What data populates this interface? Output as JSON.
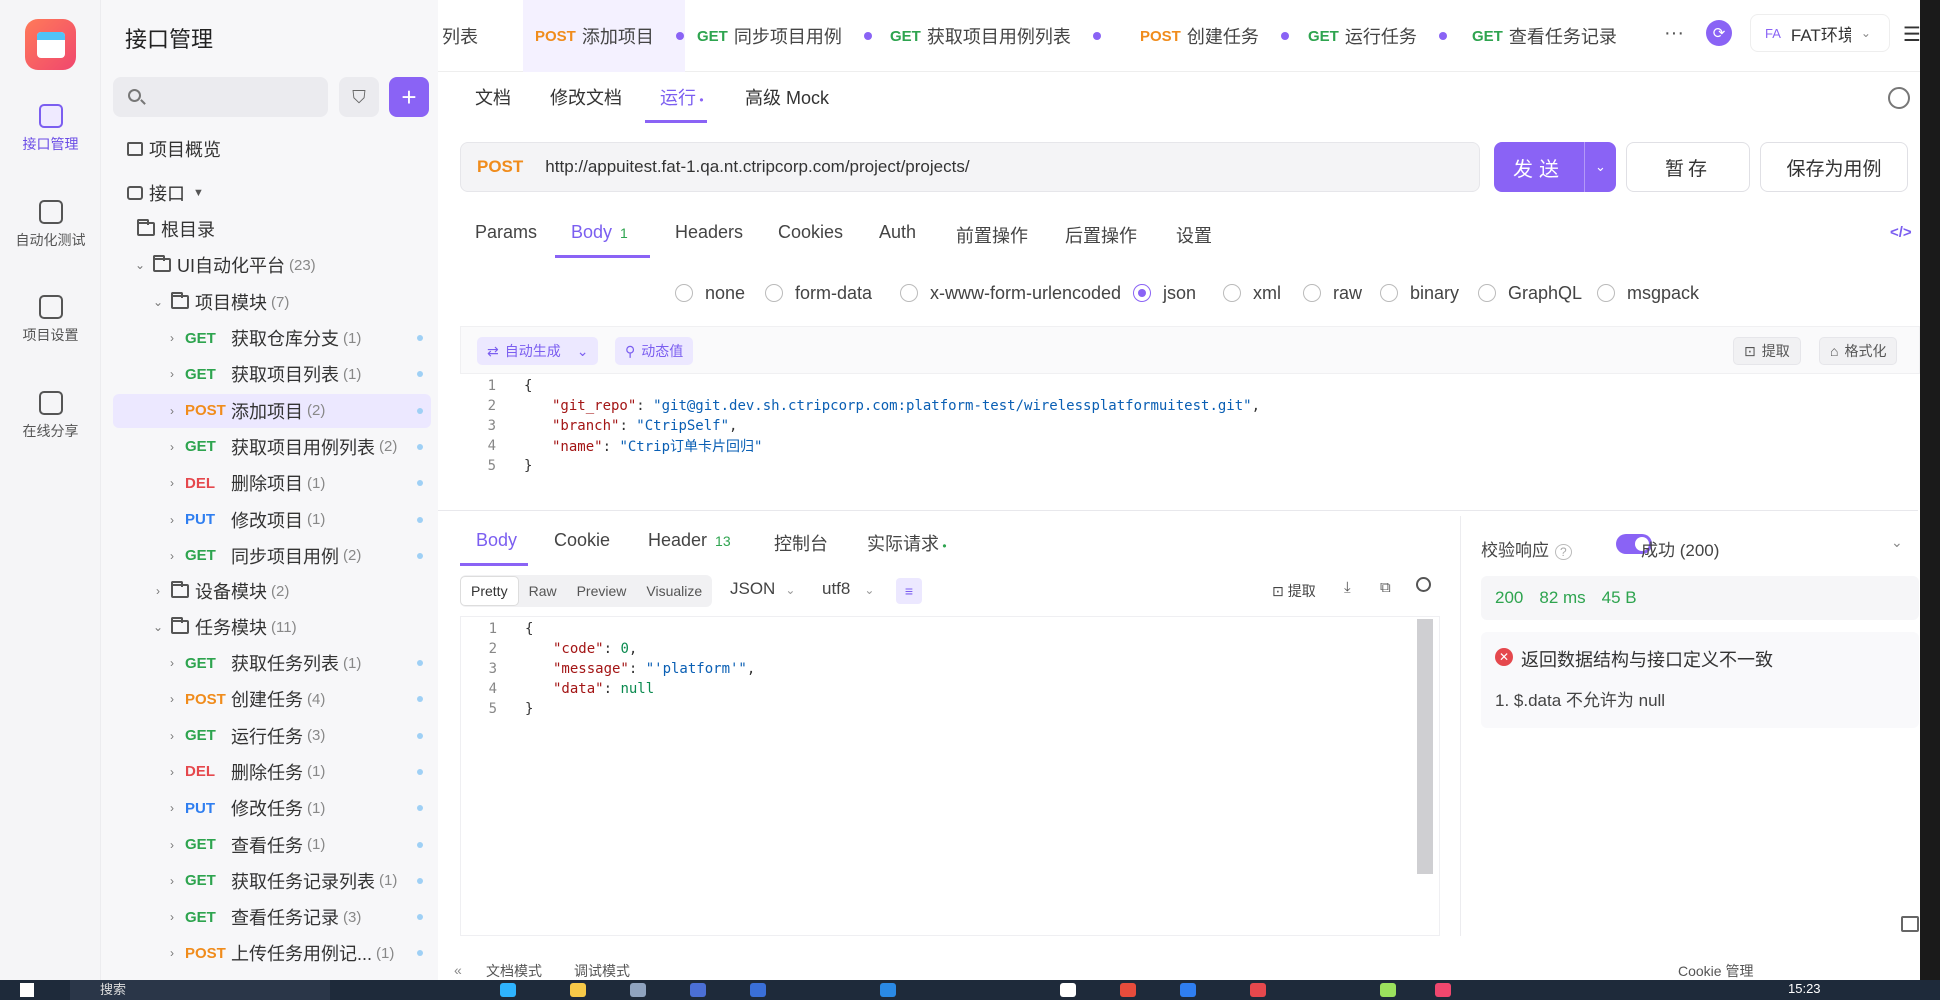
{
  "rail": {
    "items": [
      {
        "label": "接口管理",
        "icon": "api-icon"
      },
      {
        "label": "自动化测试",
        "icon": "automation-icon"
      },
      {
        "label": "项目设置",
        "icon": "settings-icon"
      },
      {
        "label": "在线分享",
        "icon": "share-icon"
      }
    ]
  },
  "sidebar": {
    "title": "接口管理",
    "search_placeholder": "",
    "overview": "项目概览",
    "api_root": "接口",
    "root_dir": "根目录",
    "platform": {
      "name": "UI自动化平台",
      "count": "(23)"
    },
    "project_module": {
      "name": "项目模块",
      "count": "(7)"
    },
    "project_items": [
      {
        "method": "GET",
        "name": "获取仓库分支",
        "count": "(1)"
      },
      {
        "method": "GET",
        "name": "获取项目列表",
        "count": "(1)"
      },
      {
        "method": "POST",
        "name": "添加项目",
        "count": "(2)"
      },
      {
        "method": "GET",
        "name": "获取项目用例列表",
        "count": "(2)"
      },
      {
        "method": "DEL",
        "name": "删除项目",
        "count": "(1)"
      },
      {
        "method": "PUT",
        "name": "修改项目",
        "count": "(1)"
      },
      {
        "method": "GET",
        "name": "同步项目用例",
        "count": "(2)"
      }
    ],
    "device_module": {
      "name": "设备模块",
      "count": "(2)"
    },
    "task_module": {
      "name": "任务模块",
      "count": "(11)"
    },
    "task_items": [
      {
        "method": "GET",
        "name": "获取任务列表",
        "count": "(1)"
      },
      {
        "method": "POST",
        "name": "创建任务",
        "count": "(4)"
      },
      {
        "method": "GET",
        "name": "运行任务",
        "count": "(3)"
      },
      {
        "method": "DEL",
        "name": "删除任务",
        "count": "(1)"
      },
      {
        "method": "PUT",
        "name": "修改任务",
        "count": "(1)"
      },
      {
        "method": "GET",
        "name": "查看任务",
        "count": "(1)"
      },
      {
        "method": "GET",
        "name": "获取任务记录列表",
        "count": "(1)"
      },
      {
        "method": "GET",
        "name": "查看任务记录",
        "count": "(3)"
      },
      {
        "method": "POST",
        "name": "上传任务用例记...",
        "count": "(1)"
      }
    ]
  },
  "tabs": {
    "partial": "列表",
    "items": [
      {
        "method": "POST",
        "name": "添加项目"
      },
      {
        "method": "GET",
        "name": "同步项目用例"
      },
      {
        "method": "GET",
        "name": "获取项目用例列表"
      },
      {
        "method": "POST",
        "name": "创建任务"
      },
      {
        "method": "GET",
        "name": "运行任务"
      },
      {
        "method": "GET",
        "name": "查看任务记录"
      }
    ],
    "more": "···",
    "env_badge": "FA",
    "env_name": "FAT环境"
  },
  "subtabs": [
    "文档",
    "修改文档",
    "运行",
    "高级 Mock"
  ],
  "request": {
    "method": "POST",
    "url": "http://appuitest.fat-1.qa.nt.ctripcorp.com/project/projects/",
    "send": "发送",
    "save": "暂存",
    "save_as_case": "保存为用例"
  },
  "param_tabs": {
    "params": "Params",
    "body": "Body",
    "body_count": "1",
    "headers": "Headers",
    "cookies": "Cookies",
    "auth": "Auth",
    "pre": "前置操作",
    "post": "后置操作",
    "settings": "设置"
  },
  "body_types": [
    "none",
    "form-data",
    "x-www-form-urlencoded",
    "json",
    "xml",
    "raw",
    "binary",
    "GraphQL",
    "msgpack"
  ],
  "body_selected": "json",
  "editor_toolbar": {
    "auto": "自动生成",
    "dynamic": "动态值",
    "extract": "提取",
    "format": "格式化"
  },
  "request_body_lines": [
    {
      "n": "1",
      "text": "{"
    },
    {
      "n": "2",
      "key": "\"git_repo\"",
      "val": "\"git@git.dev.sh.ctripcorp.com:platform-test/wirelessplatformuitest.git\"",
      "tail": ","
    },
    {
      "n": "3",
      "key": "\"branch\"",
      "val": "\"CtripSelf\"",
      "tail": ","
    },
    {
      "n": "4",
      "key": "\"name\"",
      "val": "\"Ctrip订单卡片回归\"",
      "tail": ""
    },
    {
      "n": "5",
      "text": "}"
    }
  ],
  "response": {
    "tabs": {
      "body": "Body",
      "cookie": "Cookie",
      "header": "Header",
      "header_count": "13",
      "console": "控制台",
      "actual": "实际请求"
    },
    "formats": [
      "Pretty",
      "Raw",
      "Preview",
      "Visualize"
    ],
    "lang": "JSON",
    "encoding": "utf8",
    "extract": "提取",
    "lines": [
      {
        "n": "1",
        "text": "{"
      },
      {
        "n": "2",
        "key": "\"code\"",
        "val": "0",
        "tail": ",",
        "num": true
      },
      {
        "n": "3",
        "key": "\"message\"",
        "val": "\"'platform'\"",
        "tail": ","
      },
      {
        "n": "4",
        "key": "\"data\"",
        "val": "null",
        "tail": "",
        "num": true
      },
      {
        "n": "5",
        "text": "}"
      }
    ]
  },
  "validate": {
    "label": "校验响应",
    "status": "成功 (200)",
    "code": "200",
    "time": "82 ms",
    "size": "45 B",
    "error_title": "返回数据结构与接口定义不一致",
    "error_detail": "1. $.data 不允许为 null"
  },
  "bottom": {
    "doc_mode": "文档模式",
    "debug_mode": "调试模式",
    "cookie_mgr": "Cookie 管理"
  },
  "taskbar": {
    "search": "搜索",
    "time": "15:23"
  }
}
